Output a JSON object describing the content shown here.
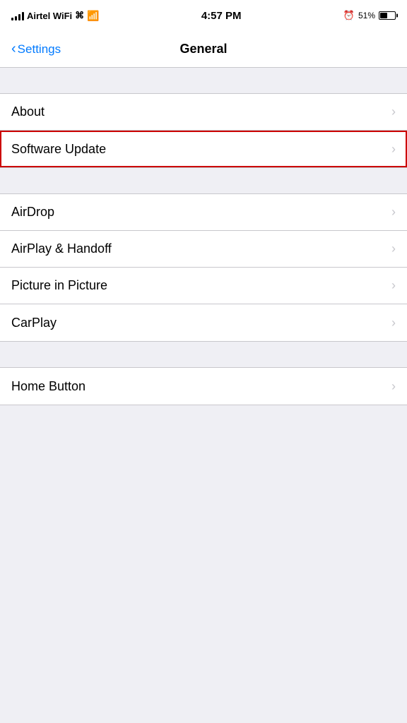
{
  "statusBar": {
    "carrier": "Airtel WiFi",
    "time": "4:57 PM",
    "battery_percent": "51%"
  },
  "navBar": {
    "back_label": "Settings",
    "title": "General"
  },
  "groups": [
    {
      "id": "group1",
      "items": [
        {
          "id": "about",
          "label": "About",
          "highlighted": false
        },
        {
          "id": "software-update",
          "label": "Software Update",
          "highlighted": true
        }
      ]
    },
    {
      "id": "group2",
      "items": [
        {
          "id": "airdrop",
          "label": "AirDrop",
          "highlighted": false
        },
        {
          "id": "airplay-handoff",
          "label": "AirPlay & Handoff",
          "highlighted": false
        },
        {
          "id": "picture-in-picture",
          "label": "Picture in Picture",
          "highlighted": false
        },
        {
          "id": "carplay",
          "label": "CarPlay",
          "highlighted": false
        }
      ]
    },
    {
      "id": "group3",
      "items": [
        {
          "id": "home-button",
          "label": "Home Button",
          "highlighted": false
        }
      ]
    }
  ]
}
